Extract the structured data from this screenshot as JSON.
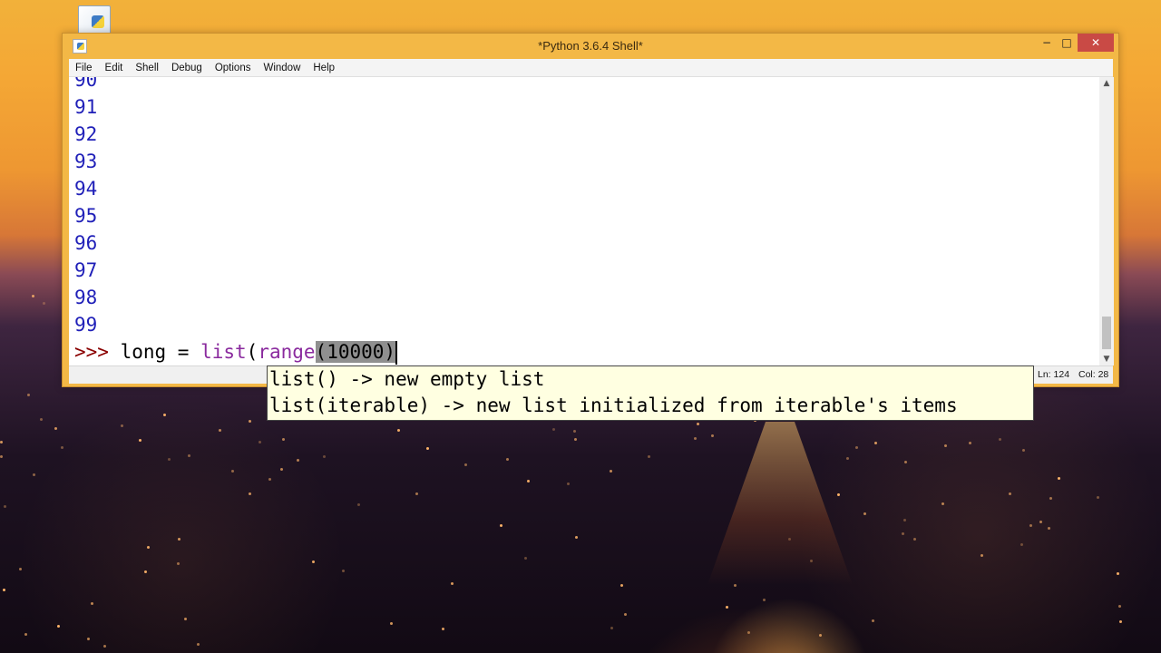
{
  "window": {
    "title": "*Python 3.6.4 Shell*",
    "controls": {
      "minimize": "−",
      "maximize": "□",
      "close": "✕"
    }
  },
  "menu": {
    "items": [
      "File",
      "Edit",
      "Shell",
      "Debug",
      "Options",
      "Window",
      "Help"
    ]
  },
  "shell": {
    "output_lines": [
      "90",
      "91",
      "92",
      "93",
      "94",
      "95",
      "96",
      "97",
      "98",
      "99"
    ],
    "prompt": ">>> ",
    "input": {
      "var": "long = ",
      "builtin1": "list",
      "paren": "(",
      "builtin2": "range",
      "selected": "(10000)"
    }
  },
  "calltip": {
    "lines": [
      "list() -> new empty list",
      "list(iterable) -> new list initialized from iterable's items"
    ]
  },
  "status": {
    "ln": "Ln: 124",
    "col": "Col: 28"
  },
  "icons": [
    "python-shell-icon",
    "desktop-file-icon",
    "scroll-up-icon",
    "scroll-down-icon"
  ]
}
